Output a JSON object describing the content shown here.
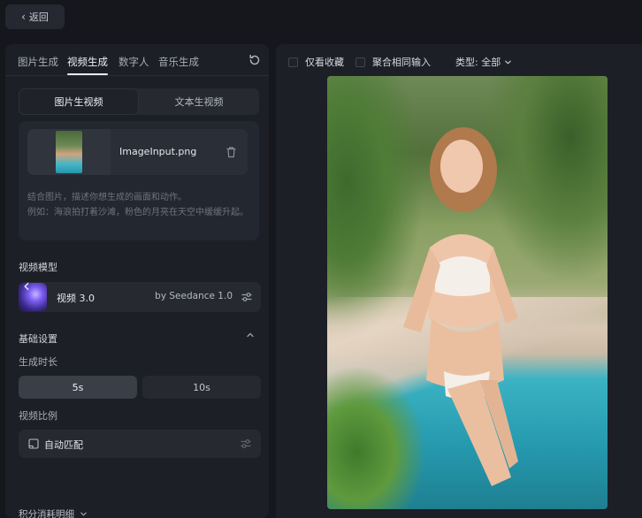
{
  "header": {
    "back_label": "返回"
  },
  "left": {
    "tabs": [
      {
        "label": "图片生成"
      },
      {
        "label": "视频生成"
      },
      {
        "label": "数字人"
      },
      {
        "label": "音乐生成"
      }
    ],
    "mode": {
      "image_to_video": "图片生视频",
      "text_to_video": "文本生视频"
    },
    "upload": {
      "file_name": "ImageInput.png",
      "prompt_line1": "结合图片，描述你想生成的画面和动作。",
      "prompt_line2": "例如：海浪拍打着沙滩，粉色的月亮在天空中缓缓升起。"
    },
    "model_section_label": "视频模型",
    "model": {
      "name": "视频 3.0",
      "by": "by Seedance 1.0"
    },
    "basic_settings_label": "基础设置",
    "duration_label": "生成时长",
    "duration_options": [
      "5s",
      "10s"
    ],
    "selected_duration": "5s",
    "ratio_label": "视频比例",
    "ratio_value": "自动匹配",
    "credits_label": "积分消耗明细"
  },
  "right": {
    "toolbar": {
      "favorites_only": "仅看收藏",
      "aggregate_same_input": "聚合相同输入",
      "type_filter": "类型: 全部"
    }
  },
  "colors": {
    "background": "#15171c",
    "panel": "#1c1f26",
    "accent": "#e8eaee",
    "selected_chip": "#3a3e47"
  }
}
